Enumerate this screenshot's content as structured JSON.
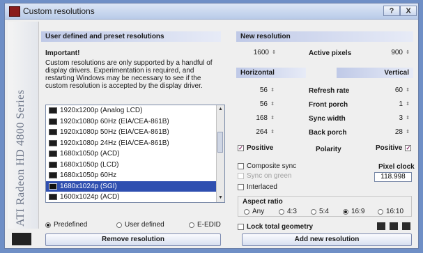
{
  "window": {
    "title": "Custom resolutions",
    "help_glyph": "?",
    "close_glyph": "X",
    "colors": {
      "title_bar": "#c8d6ee",
      "section_header": "#bfc9e7",
      "selection": "#2f4fb0",
      "accent_check": "#7a1c5c"
    }
  },
  "sidebar": {
    "brand": "ATI Radeon HD 4800 Series"
  },
  "left": {
    "section_header": "User defined and preset resolutions",
    "important_title": "Important!",
    "important_text": "Custom resolutions are only supported by a handful of display drivers. Experimentation is required, and restarting Windows may be necessary to see if the custom resolution is accepted by the display driver.",
    "list": [
      {
        "label": "1920x1200p (Analog LCD)",
        "selected": false
      },
      {
        "label": "1920x1080p 60Hz (EIA/CEA-861B)",
        "selected": false
      },
      {
        "label": "1920x1080p 50Hz (EIA/CEA-861B)",
        "selected": false
      },
      {
        "label": "1920x1080p 24Hz (EIA/CEA-861B)",
        "selected": false
      },
      {
        "label": "1680x1050p (ACD)",
        "selected": false
      },
      {
        "label": "1680x1050p (LCD)",
        "selected": false
      },
      {
        "label": "1680x1050p 60Hz",
        "selected": false
      },
      {
        "label": "1680x1024p (SGI)",
        "selected": true
      },
      {
        "label": "1600x1024p (ACD)",
        "selected": false
      }
    ],
    "scroll_up": "▲",
    "scroll_down": "▼",
    "source_options": [
      {
        "label": "Predefined",
        "selected": true
      },
      {
        "label": "User defined",
        "selected": false
      },
      {
        "label": "E-EDID",
        "selected": false
      }
    ],
    "remove_button": "Remove resolution"
  },
  "right": {
    "new_resolution_header": "New resolution",
    "width_value": "1600",
    "active_pixels_label": "Active pixels",
    "height_value": "900",
    "horizontal_header": "Horizontal",
    "vertical_header": "Vertical",
    "spin_arrow": "⇕",
    "rows": [
      {
        "label": "Refresh rate",
        "horizontal": "56",
        "vertical": "60"
      },
      {
        "label": "Front porch",
        "horizontal": "56",
        "vertical": "1"
      },
      {
        "label": "Sync width",
        "horizontal": "168",
        "vertical": "3"
      },
      {
        "label": "Back porch",
        "horizontal": "264",
        "vertical": "28"
      }
    ],
    "positive_label": "Positive",
    "polarity_label": "Polarity",
    "positive_label_v": "Positive",
    "composite_sync_label": "Composite sync",
    "sync_on_green_label": "Sync on green",
    "interlaced_label": "Interlaced",
    "pixel_clock_label": "Pixel clock",
    "pixel_clock_value": "118.998",
    "aspect_ratio_label": "Aspect ratio",
    "aspect_options": [
      {
        "label": "Any",
        "selected": false
      },
      {
        "label": "4:3",
        "selected": false
      },
      {
        "label": "5:4",
        "selected": false
      },
      {
        "label": "16:9",
        "selected": true
      },
      {
        "label": "16:10",
        "selected": false
      }
    ],
    "lock_label": "Lock total geometry",
    "add_button": "Add new resolution"
  }
}
